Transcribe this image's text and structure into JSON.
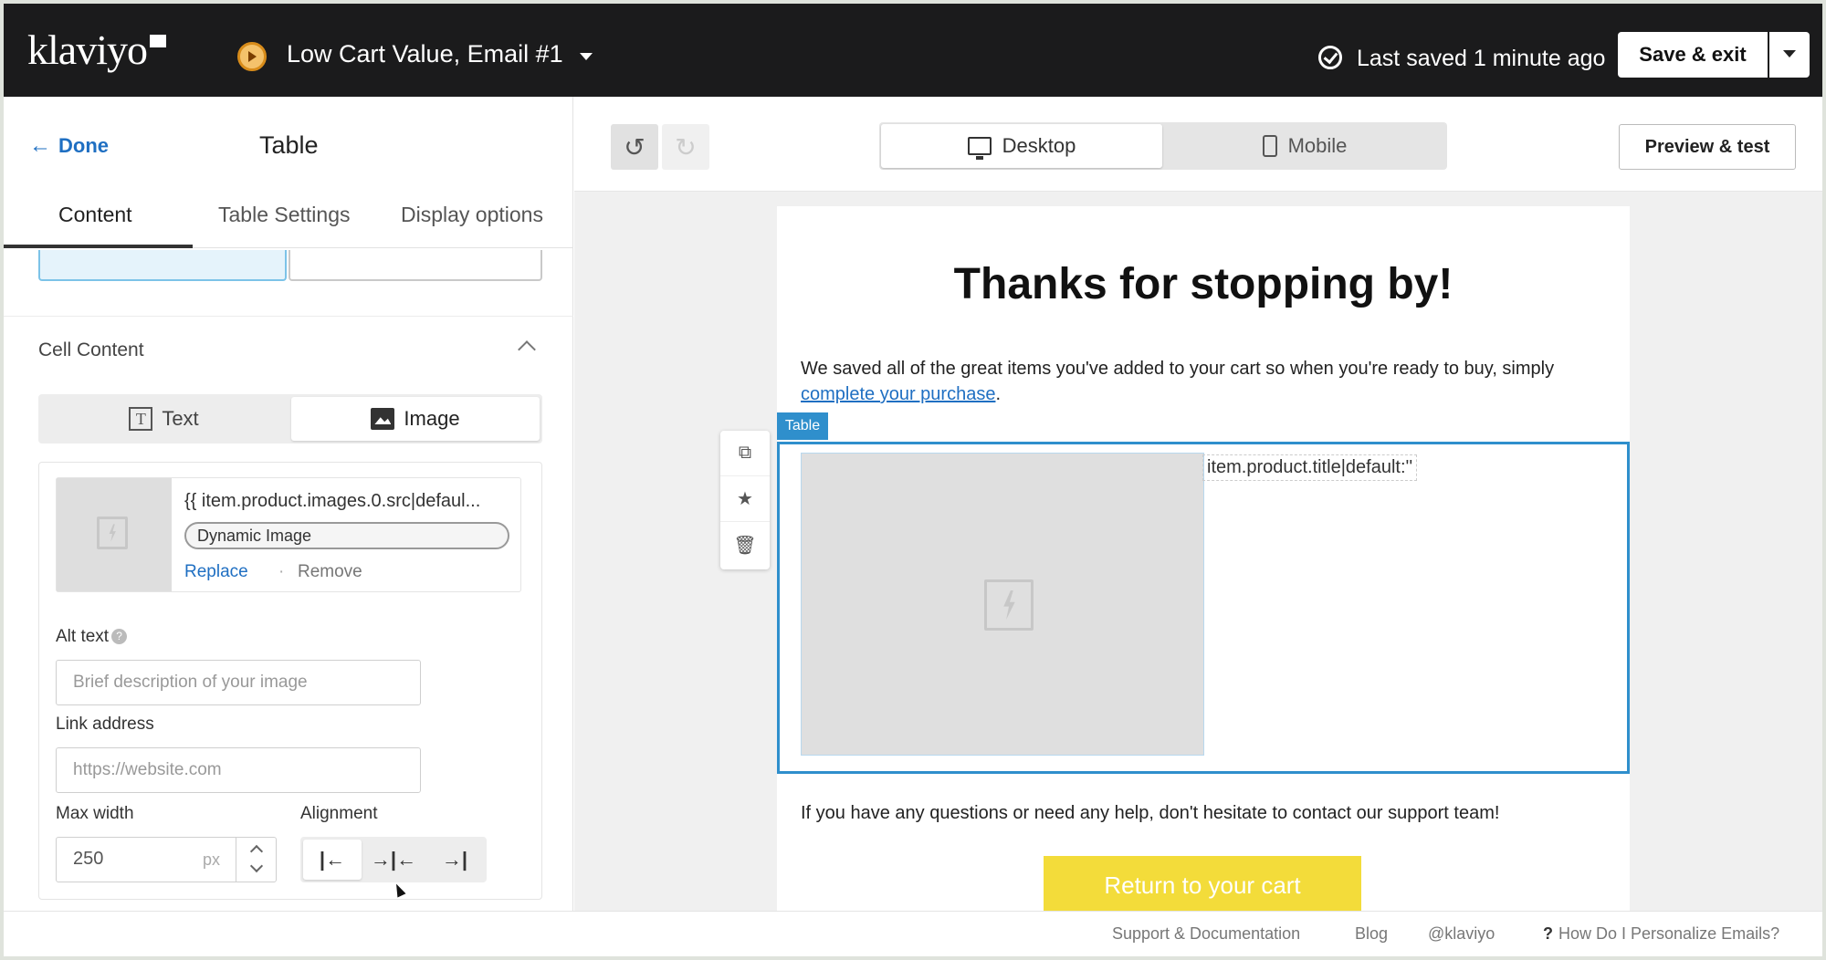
{
  "app": {
    "logo_text": "klaviyo",
    "campaign_title": "Low Cart Value, Email #1",
    "saved_status": "Last saved 1 minute ago",
    "save_exit_label": "Save & exit"
  },
  "panel": {
    "done_label": "Done",
    "title": "Table",
    "tabs": [
      {
        "label": "Content",
        "active": true
      },
      {
        "label": "Table Settings",
        "active": false
      },
      {
        "label": "Display options",
        "active": false
      }
    ],
    "cell_content_label": "Cell Content",
    "content_types": [
      {
        "label": "Text",
        "icon": "text-icon",
        "selected": false
      },
      {
        "label": "Image",
        "icon": "image-icon",
        "selected": true
      }
    ],
    "image": {
      "source": "{{ item.product.images.0.src|defaul...",
      "badge": "Dynamic Image",
      "replace_label": "Replace",
      "separator": "·",
      "remove_label": "Remove"
    },
    "alt_text": {
      "label": "Alt text",
      "help": "?",
      "placeholder": "Brief description of your image"
    },
    "link_address": {
      "label": "Link address",
      "placeholder": "https://website.com"
    },
    "max_width": {
      "label": "Max width",
      "value": "250",
      "unit": "px"
    },
    "alignment": {
      "label": "Alignment",
      "options": [
        "|←",
        "→|←",
        "→|"
      ],
      "selected": 0
    }
  },
  "toolbar": {
    "undo_icon": "↺",
    "redo_icon": "↻",
    "desktop_label": "Desktop",
    "mobile_label": "Mobile",
    "preview_label": "Preview & test"
  },
  "email": {
    "heading": "Thanks for stopping by!",
    "para_before_link": "We saved all of the great items you've added to your cart so when you're ready to buy, simply ",
    "link_text": "complete your purchase",
    "para_after_link": ".",
    "table_tag": "Table",
    "cell_text": "item.product.title|default:''",
    "support_text": "If you have any questions or need any help, don't hesitate to contact our support team!",
    "cta_label": "Return to your cart",
    "tools": [
      "duplicate-icon",
      "star-icon",
      "trash-icon"
    ]
  },
  "footer": {
    "links": [
      "Support & Documentation",
      "Blog",
      "@klaviyo",
      "How Do I Personalize Emails?"
    ],
    "help_icon": "?"
  },
  "colors": {
    "topbar": "#1b1b1c",
    "accent_blue": "#1f6fc2",
    "selection_blue": "#2f8fcc",
    "cta_yellow": "#f3dc3a"
  }
}
